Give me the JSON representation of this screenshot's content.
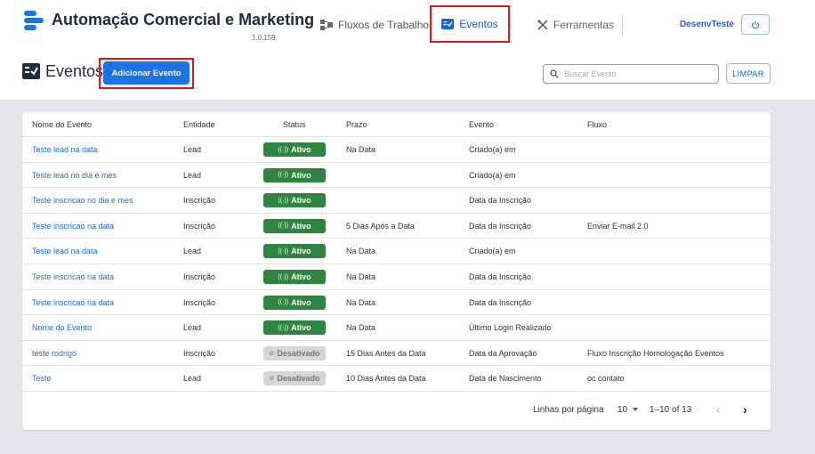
{
  "header": {
    "app_title": "Automação Comercial e Marketing",
    "version": "1.0.159",
    "nav": [
      {
        "label": "Fluxos de Trabalho",
        "icon": "workflow-icon"
      },
      {
        "label": "Eventos",
        "icon": "events-icon",
        "active": true
      },
      {
        "label": "Ferramentas",
        "icon": "tools-icon"
      }
    ],
    "user": "DesenvTeste",
    "power_icon": "power-icon"
  },
  "page": {
    "title": "Eventos",
    "add_button": "Adicionar Evento",
    "search_placeholder": "Buscar Evento",
    "clear_button": "LIMPAR"
  },
  "table": {
    "columns": [
      "Nome do Evento",
      "Entidade",
      "Status",
      "Prazo",
      "Evento",
      "Fluxo"
    ],
    "rows": [
      {
        "name": "Teste lead na data",
        "entity": "Lead",
        "status": "Ativo",
        "active": true,
        "deadline": "Na Data",
        "event": "Criado(a) em",
        "flow": ""
      },
      {
        "name": "Teste lead no dia e mes",
        "entity": "Lead",
        "status": "Ativo",
        "active": true,
        "deadline": "",
        "event": "Criado(a) em",
        "flow": ""
      },
      {
        "name": "Teste inscricao no dia e mes",
        "entity": "Inscrição",
        "status": "Ativo",
        "active": true,
        "deadline": "",
        "event": "Data da Inscrição",
        "flow": ""
      },
      {
        "name": "Teste inscricao na data",
        "entity": "Inscrição",
        "status": "Ativo",
        "active": true,
        "deadline": "5 Dias Após a Data",
        "event": "Data da Inscrição",
        "flow": "Enviar E-mail 2.0"
      },
      {
        "name": "Teste lead na data",
        "entity": "Lead",
        "status": "Ativo",
        "active": true,
        "deadline": "Na Data",
        "event": "Criado(a) em",
        "flow": ""
      },
      {
        "name": "Teste inscricao na data",
        "entity": "Inscrição",
        "status": "Ativo",
        "active": true,
        "deadline": "Na Data",
        "event": "Data da Inscrição",
        "flow": ""
      },
      {
        "name": "Teste inscricao na data",
        "entity": "Inscrição",
        "status": "Ativo",
        "active": true,
        "deadline": "Na Data",
        "event": "Data da Inscrição",
        "flow": ""
      },
      {
        "name": "Nome do Evento",
        "entity": "Lead",
        "status": "Ativo",
        "active": true,
        "deadline": "Na Data",
        "event": "Último Login Realizado",
        "flow": ""
      },
      {
        "name": "teste rodrigo",
        "entity": "Inscrição",
        "status": "Desativado",
        "active": false,
        "deadline": "15 Dias Antes da Data",
        "event": "Data da Aprovação",
        "flow": "Fluxo Inscrição Homologação Eventos"
      },
      {
        "name": "Teste",
        "entity": "Lead",
        "status": "Desativado",
        "active": false,
        "deadline": "10 Dias Antes da Data",
        "event": "Data de Nascimento",
        "flow": "oc contato"
      }
    ]
  },
  "pagination": {
    "rows_per_page_label": "Linhas por página",
    "rows_per_page": "10",
    "range": "1–10 of 13"
  },
  "colors": {
    "accent": "#1a73e8",
    "active_badge": "#2e8540",
    "inactive_badge": "#d6d6d6",
    "highlight_frame": "#e0141b"
  }
}
